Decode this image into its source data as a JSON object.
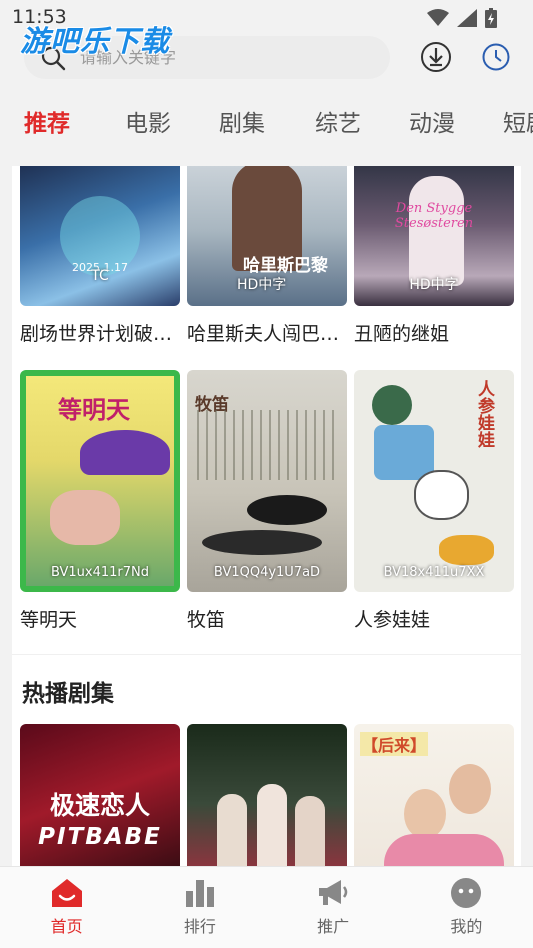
{
  "status": {
    "time": "11:53"
  },
  "watermark": "游吧乐下载",
  "search": {
    "placeholder": "请输入关键字"
  },
  "tabs": [
    {
      "label": "推荐",
      "active": true
    },
    {
      "label": "电影",
      "active": false
    },
    {
      "label": "剧集",
      "active": false
    },
    {
      "label": "综艺",
      "active": false
    },
    {
      "label": "动漫",
      "active": false
    },
    {
      "label": "短剧",
      "active": false
    }
  ],
  "row1": [
    {
      "title": "剧场世界计划破…",
      "tag": "TC",
      "poster_text": "2025.1.17"
    },
    {
      "title": "哈里斯夫人闯巴…",
      "tag": "HD中字",
      "poster_text": "哈里斯巴黎"
    },
    {
      "title": "丑陋的继姐",
      "tag": "HD中字",
      "poster_text": "Den Stygge Stesøsteren"
    }
  ],
  "row2": [
    {
      "title": "等明天",
      "tag": "BV1ux411r7Nd",
      "poster_text": "等明天"
    },
    {
      "title": "牧笛",
      "tag": "BV1QQ4y1U7aD",
      "poster_text": "牧笛"
    },
    {
      "title": "人参娃娃",
      "tag": "BV18x411u7XX",
      "poster_text": "人参娃娃"
    }
  ],
  "section_hot": "热播剧集",
  "row3": [
    {
      "poster_text": "极速恋人",
      "poster_sub": "PITBABE"
    },
    {
      "poster_text": ""
    },
    {
      "poster_text": "【后来】"
    }
  ],
  "bottom_nav": [
    {
      "label": "首页",
      "icon": "home-icon",
      "active": true
    },
    {
      "label": "排行",
      "icon": "bar-chart-icon",
      "active": false
    },
    {
      "label": "推广",
      "icon": "megaphone-icon",
      "active": false
    },
    {
      "label": "我的",
      "icon": "profile-face-icon",
      "active": false
    }
  ],
  "colors": {
    "accent": "#e02a2a",
    "watermark": "#1a8be6"
  }
}
